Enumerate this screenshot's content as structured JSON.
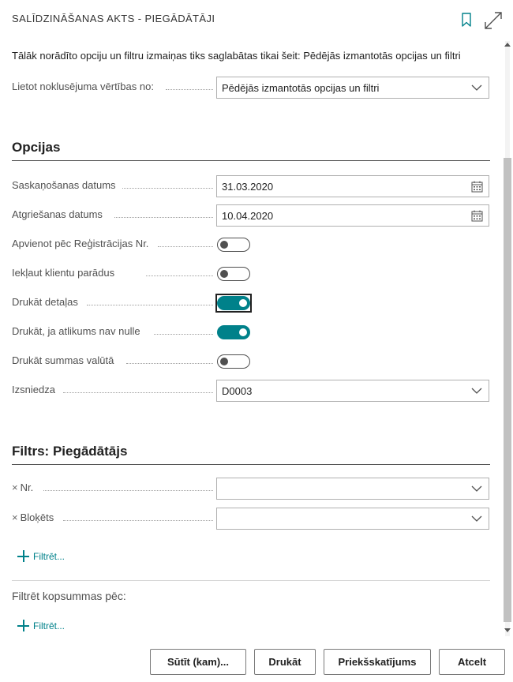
{
  "header": {
    "title": "SALĪDZINĀŠANAS AKTS - PIEGĀDĀTĀJI",
    "bookmark_icon": "bookmark-icon",
    "expand_icon": "expand-icon",
    "accent_color": "#00818a"
  },
  "info_text": "Tālāk norādīto opciju un filtru izmaiņas tiks saglabātas tikai šeit: Pēdējās izmantotās opcijas un filtri",
  "defaults": {
    "label": "Lietot noklusējuma vērtības no:",
    "value": "Pēdējās izmantotās opcijas un filtri"
  },
  "options": {
    "heading": "Opcijas",
    "reconciliation_date": {
      "label": "Saskaņošanas datums",
      "value": "31.03.2020"
    },
    "return_date": {
      "label": "Atgriešanas datums",
      "value": "10.04.2020"
    },
    "combine_by_reg_no": {
      "label": "Apvienot pēc Reģistrācijas Nr.",
      "on": false
    },
    "include_customer_debts": {
      "label": "Iekļaut klientu parādus",
      "on": false
    },
    "print_details": {
      "label": "Drukāt detaļas",
      "on": true
    },
    "print_if_balance_nonzero": {
      "label": "Drukāt, ja atlikums nav nulle",
      "on": true
    },
    "print_amounts_in_currency": {
      "label": "Drukāt summas valūtā",
      "on": false
    },
    "issued_by": {
      "label": "Izsniedza",
      "value": "D0003"
    }
  },
  "filter_vendor": {
    "heading": "Filtrs: Piegādātājs",
    "fields": [
      {
        "remove_icon": "×",
        "label": "Nr.",
        "value": ""
      },
      {
        "remove_icon": "×",
        "label": "Bloķēts",
        "value": ""
      }
    ],
    "add_filter_label": "Filtrēt..."
  },
  "totals_filter": {
    "heading": "Filtrēt kopsummas pēc:",
    "add_filter_label": "Filtrēt..."
  },
  "footer": {
    "send_label": "Sūtīt (kam)...",
    "print_label": "Drukāt",
    "preview_label": "Priekšskatījums",
    "cancel_label": "Atcelt"
  }
}
